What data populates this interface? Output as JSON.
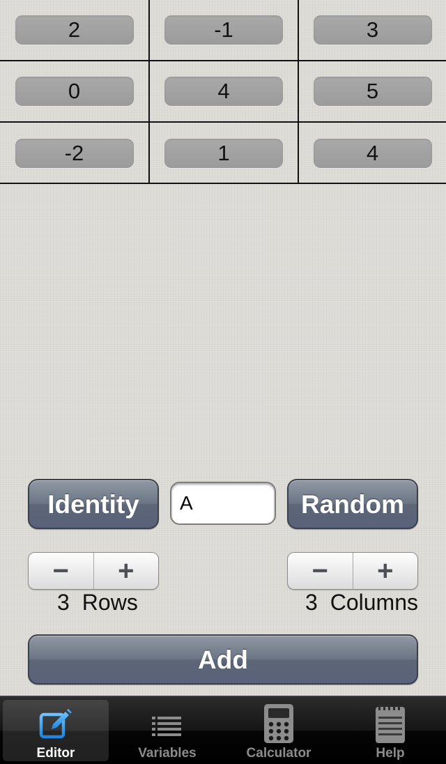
{
  "matrix": {
    "rows": [
      [
        "2",
        "-1",
        "3"
      ],
      [
        "0",
        "4",
        "5"
      ],
      [
        "-2",
        "1",
        "4"
      ]
    ]
  },
  "controls": {
    "identity_label": "Identity",
    "random_label": "Random",
    "matrix_name": "A",
    "add_label": "Add",
    "minus_symbol": "−",
    "plus_symbol": "+",
    "rows_value": "3",
    "rows_label": "Rows",
    "columns_value": "3",
    "columns_label": "Columns"
  },
  "tabbar": {
    "tabs": [
      {
        "label": "Editor",
        "icon": "edit-icon",
        "active": true
      },
      {
        "label": "Variables",
        "icon": "list-icon",
        "active": false
      },
      {
        "label": "Calculator",
        "icon": "calculator-icon",
        "active": false
      },
      {
        "label": "Help",
        "icon": "notepad-icon",
        "active": false
      }
    ]
  },
  "colors": {
    "accent_blue": "#2f9ff2",
    "button_slate": "#6c7685"
  }
}
